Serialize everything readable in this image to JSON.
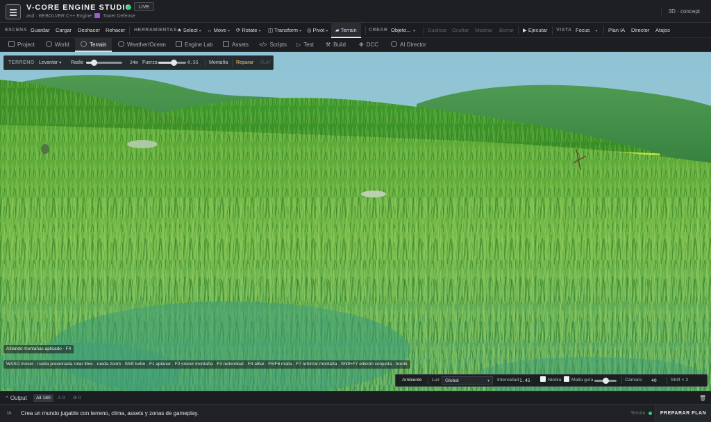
{
  "header": {
    "title": "V-CORE ENGINE STUDIO",
    "live_badge": "LIVE",
    "subtitle_parts": [
      "asd · REBOLVER C++ Engine",
      "Tower Defense"
    ],
    "view_mode": "3D · concept"
  },
  "toolbar": {
    "escena_label": "ESCENA",
    "guardar": "Guardar",
    "cargar": "Cargar",
    "deshacer": "Deshacer",
    "rehacer": "Rehacer",
    "herramientas_label": "HERRAMIENTAS",
    "select": "Select",
    "move": "Move",
    "rotate": "Rotate",
    "transform": "Transform",
    "pivot": "Pivot",
    "terrain": "Terrain",
    "crear_label": "CREAR",
    "objeto": "Objeto...",
    "duplicar": "Duplicar",
    "ocultar": "Ocultar",
    "mostrar": "Mostrar",
    "borrar": "Borrar",
    "ejecutar": "Ejecutar",
    "vista_label": "VISTA",
    "focus": "Focus",
    "plan_ia": "Plan IA",
    "director": "Director",
    "atajos": "Atajos"
  },
  "tabs": [
    "Project",
    "World",
    "Terrain",
    "Weather/Ocean",
    "Engine Lab",
    "Assets",
    "Scripts",
    "Test",
    "Build",
    "DCC",
    "AI Director"
  ],
  "active_tab": "Terrain",
  "terrain_toolbar": {
    "label": "TERRENO",
    "mode": "Levantar",
    "radio_label": "Radio",
    "radio_value": "24m",
    "radio_level": 0.22,
    "fuerza_label": "Fuerza",
    "fuerza_value": "0.55",
    "fuerza_level": 0.55,
    "preset": "Montaña",
    "repair": "Reparar",
    "extra": "FLAT"
  },
  "viewport": {
    "status_message": "Afilando montañas aplicado · F4",
    "help_text": "WASD mover · rueda presionada rotar libre · rueda zoom · Shift turbo · F1 aplanar · F2 crecer montaña · F3 redondear · F4 afilar · F5/F6 malla · F7 reforzar montaña · Shift+F7 edición conjunta · borde",
    "colors": {
      "sky": "#9bc7d6",
      "grass_dark": "#3f8a28",
      "grass_light": "#7cc04a",
      "ground": "#3a9c6a"
    }
  },
  "environment_bar": {
    "title": "Ambiente",
    "luz_label": "Luz",
    "luz_value": "Global",
    "intensidad_label": "Intensidad",
    "intensidad_value": "1.45",
    "niebla_label": "Niebla",
    "malla_label": "Malla guía",
    "camara_label": "Cámara",
    "camara_value": "40",
    "shift_label": "Shift × 2"
  },
  "output": {
    "label": "Output",
    "all_badge": "All 180",
    "warnings": "0",
    "errors": "0"
  },
  "prompt": {
    "label": "IA",
    "text": "Crea un mundo jugable con terreno, clima, assets y zonas de gameplay.",
    "status": "Terrain",
    "button": "PREPARAR PLAN"
  }
}
